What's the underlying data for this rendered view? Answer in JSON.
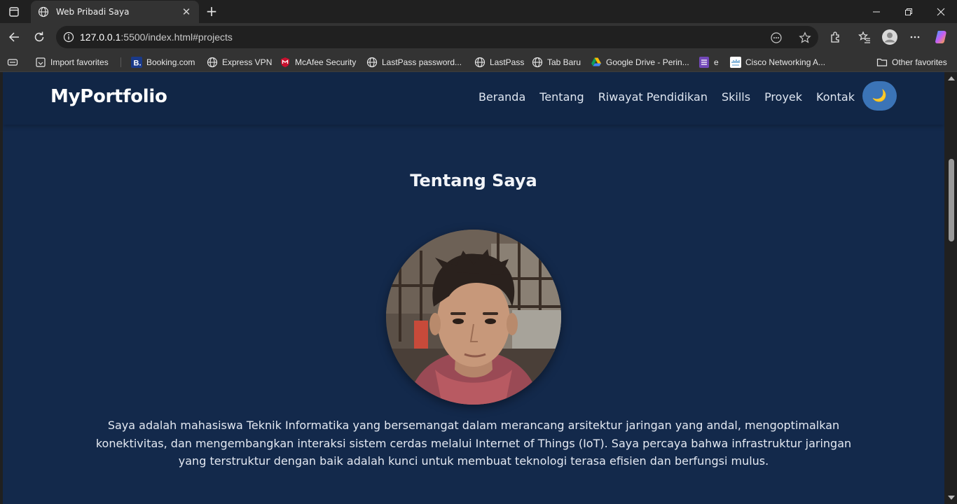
{
  "browser": {
    "tab_title": "Web Pribadi Saya",
    "url_host": "127.0.0.1",
    "url_path": ":5500/index.html#projects",
    "favorites": [
      {
        "label": "Import favorites",
        "icon": "import-icon"
      },
      {
        "label": "Booking.com",
        "icon": "booking-icon"
      },
      {
        "label": "Express VPN",
        "icon": "globe-icon"
      },
      {
        "label": "McAfee Security",
        "icon": "mcafee-icon"
      },
      {
        "label": "LastPass password...",
        "icon": "globe-icon"
      },
      {
        "label": "LastPass",
        "icon": "globe-icon"
      },
      {
        "label": "Tab Baru",
        "icon": "globe-icon"
      },
      {
        "label": "Google Drive - Perin...",
        "icon": "google-drive-icon"
      },
      {
        "label": "e",
        "icon": "forms-icon"
      },
      {
        "label": "Cisco Networking A...",
        "icon": "cisco-icon"
      }
    ],
    "other_favorites": "Other favorites"
  },
  "site": {
    "brand": "MyPortfolio",
    "nav": [
      "Beranda",
      "Tentang",
      "Riwayat Pendidikan",
      "Skills",
      "Proyek",
      "Kontak"
    ],
    "theme_toggle": "🌙",
    "section_title": "Tentang Saya",
    "bio": "Saya adalah mahasiswa Teknik Informatika yang bersemangat dalam merancang arsitektur jaringan yang andal, mengoptimalkan konektivitas, dan mengembangkan interaksi sistem cerdas melalui Internet of Things (IoT). Saya percaya bahwa infrastruktur jaringan yang terstruktur dengan baik adalah kunci untuk membuat teknologi terasa efisien dan berfungsi mulus."
  },
  "colors": {
    "page_bg": "#13294b",
    "navbar_bg": "#112646",
    "toggle_bg": "#3b74b7"
  }
}
